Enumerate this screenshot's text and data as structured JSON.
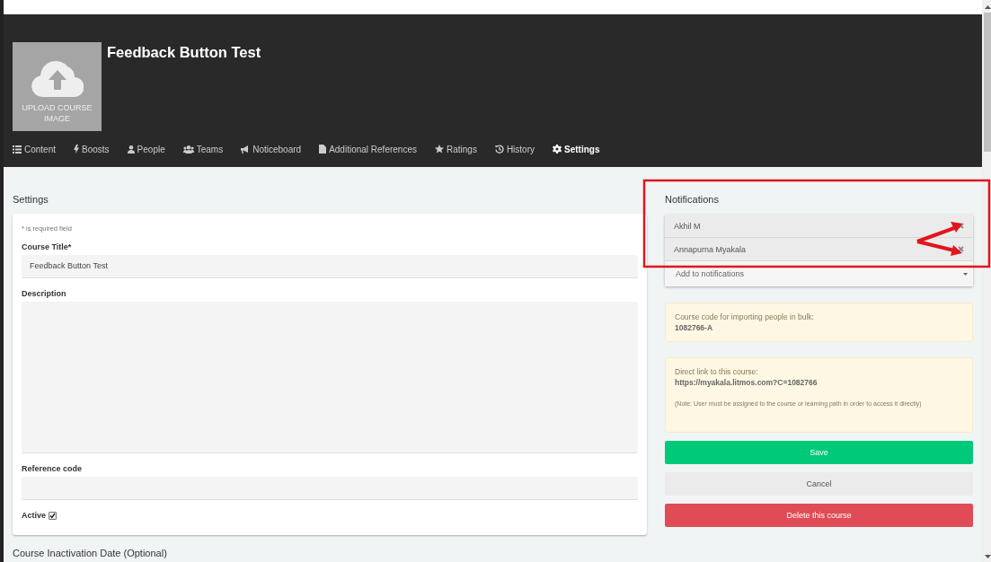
{
  "course": {
    "title": "Feedback Button Test",
    "upload_label": "UPLOAD COURSE IMAGE"
  },
  "tabs": [
    {
      "label": "Content",
      "selected": false
    },
    {
      "label": "Boosts",
      "selected": false
    },
    {
      "label": "People",
      "selected": false
    },
    {
      "label": "Teams",
      "selected": false
    },
    {
      "label": "Noticeboard",
      "selected": false
    },
    {
      "label": "Additional References",
      "selected": false
    },
    {
      "label": "Ratings",
      "selected": false
    },
    {
      "label": "History",
      "selected": false
    },
    {
      "label": "Settings",
      "selected": true
    }
  ],
  "settings": {
    "heading": "Settings",
    "required_note": "* is required field",
    "title_label": "Course Title*",
    "title_value": "Feedback Button Test",
    "description_label": "Description",
    "reference_label": "Reference code",
    "active_label": "Active",
    "active_checked": true
  },
  "inactivation_heading": "Course Inactivation Date (Optional)",
  "notifications": {
    "heading": "Notifications",
    "people": [
      "Akhil M",
      "Annapurna Myakala"
    ],
    "placeholder": "Add to notifications"
  },
  "course_code": {
    "label": "Course code for importing people in bulk:",
    "value": "1082766-A"
  },
  "direct_link": {
    "label": "Direct link to this course:",
    "url": "https://myakala.litmos.com?C=1082766",
    "note": "(Note: User must be assigned to the course or learning path in order to access it directly)"
  },
  "buttons": [
    {
      "label": "Save",
      "kind": "primary"
    },
    {
      "label": "Cancel",
      "kind": "secondary"
    },
    {
      "label": "Delete this course",
      "kind": "danger"
    }
  ]
}
